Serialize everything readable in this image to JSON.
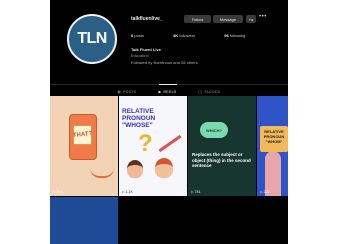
{
  "profile": {
    "avatar_text": "TLN",
    "username": "talkfluenlive_",
    "follow_label": "Follow",
    "message_label": "Message",
    "suggest_label": "+a",
    "more_icon": "more-icon",
    "stats": {
      "posts_count": "6",
      "posts_label": "posts",
      "followers_count": "4K",
      "followers_label": "followers",
      "following_count": "96",
      "following_label": "following"
    },
    "bio_name": "Talk Fluent Live",
    "bio_category": "Education",
    "bio_followed_by": "Followed by fluentnoun and 28 others"
  },
  "tabs": [
    {
      "label": "POSTS",
      "icon": "grid-icon",
      "active": false
    },
    {
      "label": "REELS",
      "icon": "reels-icon",
      "active": true
    },
    {
      "label": "TAGGED",
      "icon": "tag-icon",
      "active": false
    }
  ],
  "posts": [
    {
      "text": "THAT?",
      "views": "546",
      "colors": {
        "bg": "#f3d3b6"
      }
    },
    {
      "title": "RELATIVE PRONOUN \"WHOSE\"",
      "views": "1.1K",
      "colors": {
        "bg": "#f6f7fb"
      }
    },
    {
      "bubble": "WHICH?",
      "text": "Replaces the subject or object (thing) in the second sentence",
      "views": "741",
      "colors": {
        "bg": "#16362f"
      }
    },
    {
      "title": "RELATIVE PRONOUN \"WHOM\"",
      "views": "222",
      "colors": {
        "bg": "#2f54c8"
      }
    },
    {
      "views": "",
      "colors": {
        "bg": "#1d4b95"
      }
    }
  ]
}
